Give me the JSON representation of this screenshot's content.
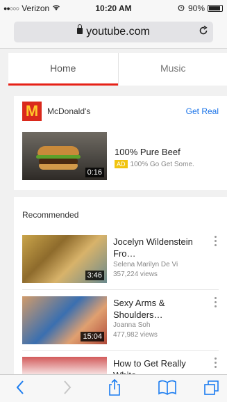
{
  "status": {
    "carrier": "Verizon",
    "signal_dots": "●●○○○",
    "time": "10:20 AM",
    "battery": "90%",
    "wifi_icon": "wifi-icon"
  },
  "browser": {
    "url": "youtube.com"
  },
  "tabs": [
    {
      "label": "Home"
    },
    {
      "label": "Music"
    }
  ],
  "ad": {
    "brand": "McDonald's",
    "cta": "Get Real",
    "title": "100% Pure Beef",
    "badge": "AD",
    "subtitle": "100% Go Get Some.",
    "duration": "0:16",
    "logo_letter": "M"
  },
  "recommended": {
    "title": "Recommended",
    "videos": [
      {
        "title": "Jocelyn Wildenstein Fro…",
        "channel": "Selena Marilyn De Vi",
        "views": "357,224 views",
        "duration": "3:46"
      },
      {
        "title": "Sexy Arms & Shoulders…",
        "channel": "Joanna Soh",
        "views": "477,982 views",
        "duration": "15:04"
      },
      {
        "title": "How to Get Really White",
        "channel": "",
        "views": "",
        "duration": ""
      }
    ]
  },
  "colors": {
    "accent_red": "#e62117",
    "link_blue": "#1a73e8",
    "ios_blue": "#1a7cf0"
  }
}
